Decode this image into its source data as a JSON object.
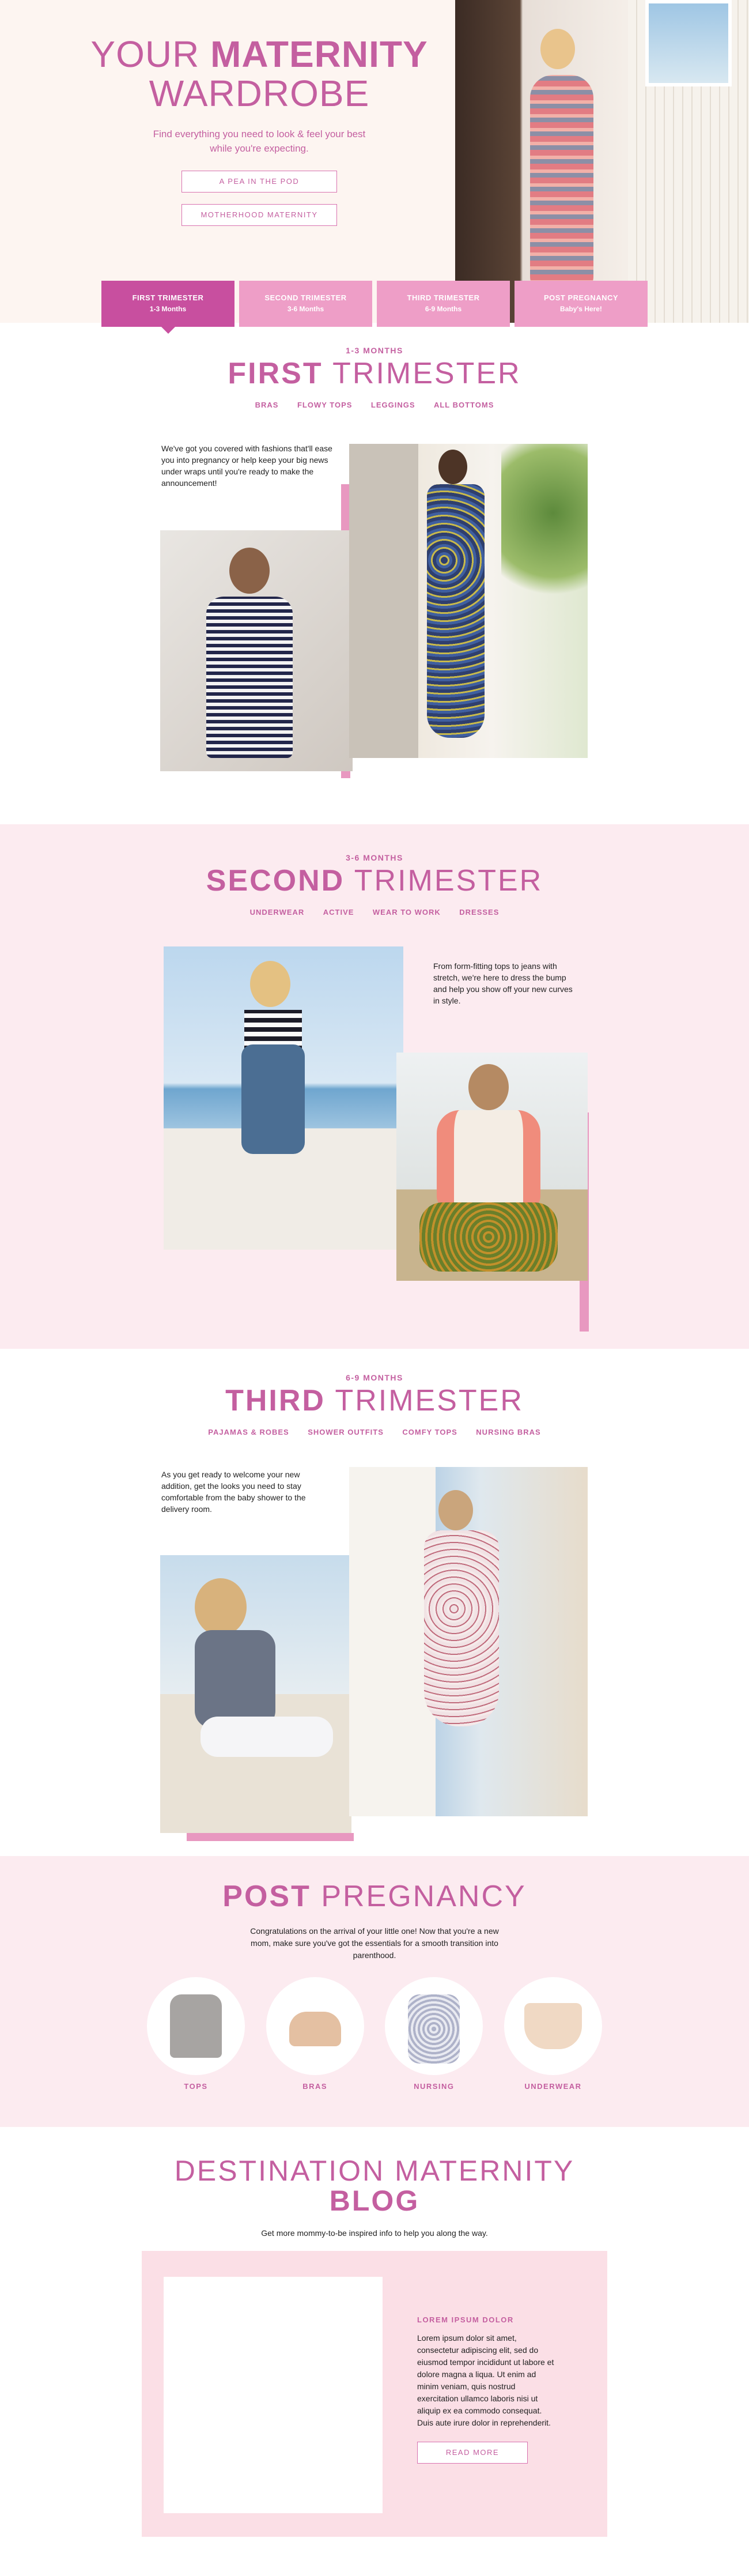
{
  "hero": {
    "title_prefix": "YOUR",
    "title_bold": "MATERNITY",
    "title_line2": "WARDROBE",
    "subtitle": "Find everything you need to look & feel your best while you're expecting.",
    "buttons": [
      "A PEA IN THE POD",
      "MOTHERHOOD MATERNITY"
    ]
  },
  "tabs": [
    {
      "label": "FIRST TRIMESTER",
      "sub": "1-3 Months",
      "active": true
    },
    {
      "label": "SECOND TRIMESTER",
      "sub": "3-6 Months",
      "active": false
    },
    {
      "label": "THIRD TRIMESTER",
      "sub": "6-9 Months",
      "active": false
    },
    {
      "label": "POST PREGNANCY",
      "sub": "Baby's Here!",
      "active": false
    }
  ],
  "first": {
    "months": "1-3 MONTHS",
    "title_bold": "FIRST",
    "title_light": "TRIMESTER",
    "links": [
      "BRAS",
      "FLOWY TOPS",
      "LEGGINGS",
      "ALL BOTTOMS"
    ],
    "blurb": "We've got you covered with fashions that'll ease you into pregnancy or help keep your big news under wraps until you're ready to make the announcement!"
  },
  "second": {
    "months": "3-6 MONTHS",
    "title_bold": "SECOND",
    "title_light": "TRIMESTER",
    "links": [
      "UNDERWEAR",
      "ACTIVE",
      "WEAR TO WORK",
      "DRESSES"
    ],
    "blurb": "From form-fitting tops to jeans with stretch, we're here to dress the bump and help you show off your new curves in style."
  },
  "third": {
    "months": "6-9 MONTHS",
    "title_bold": "THIRD",
    "title_light": "TRIMESTER",
    "links": [
      "PAJAMAS & ROBES",
      "SHOWER OUTFITS",
      "COMFY TOPS",
      "NURSING BRAS"
    ],
    "blurb": "As you get ready to welcome your new addition, get the looks you need to stay comfortable from the baby shower to the delivery room."
  },
  "post": {
    "title_bold": "POST",
    "title_light": "PREGNANCY",
    "text": "Congratulations on the arrival of your little one! Now that you're a new mom, make sure you've got the essentials for a smooth transition into parenthood.",
    "items": [
      "TOPS",
      "BRAS",
      "NURSING",
      "UNDERWEAR"
    ]
  },
  "blog": {
    "title_line1": "DESTINATION MATERNITY",
    "title_line2": "BLOG",
    "subtitle": "Get more mommy-to-be inspired info to help you along the way.",
    "card_heading": "LOREM IPSUM DOLOR",
    "card_text": "Lorem ipsum dolor sit amet, consectetur adipiscing elit, sed do eiusmod tempor incididunt ut labore et dolore magna a liqua. Ut enim ad minim veniam, quis nostrud exercitation ullamco laboris nisi ut aliquip ex ea commodo consequat. Duis aute irure dolor in reprehenderit.",
    "card_button": "READ MORE"
  },
  "colors": {
    "brand_pink": "#c45fa0",
    "tab_pink": "#ee9ec7",
    "tab_active": "#c84f9f",
    "section_pink_bg": "#fcebf0",
    "accent_pink": "#e898c0"
  }
}
